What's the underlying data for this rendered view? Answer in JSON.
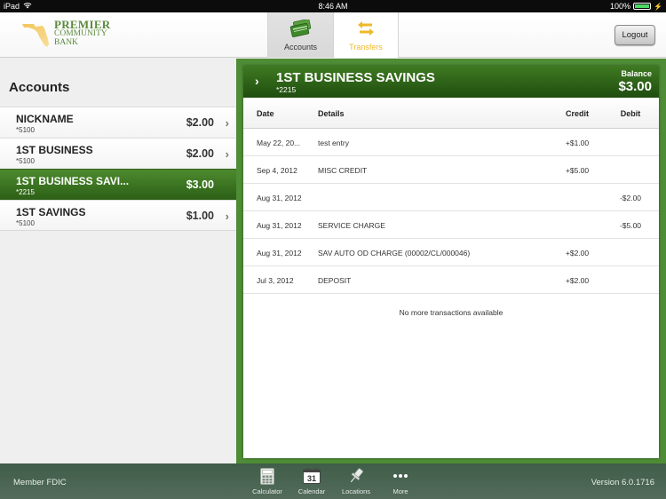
{
  "status_bar": {
    "device": "iPad",
    "time": "8:46 AM",
    "battery": "100%",
    "battery_level": 1.0
  },
  "header": {
    "logo": {
      "line1": "PREMIER",
      "line2": "COMMUNITY",
      "line3": "BANK",
      "icon": "florida-state-icon"
    },
    "tabs": [
      {
        "label": "Accounts",
        "icon": "credit-cards-icon",
        "active": true
      },
      {
        "label": "Transfers",
        "icon": "transfer-arrows-icon",
        "active": false
      }
    ],
    "logout_label": "Logout"
  },
  "colors": {
    "brand_green": "#3f7a22",
    "frame_green": "#4f8c36",
    "transfers_yellow": "#f0b92a",
    "footer_bg": "#4a6552"
  },
  "accounts_panel": {
    "title": "Accounts",
    "accounts": [
      {
        "name": "NICKNAME",
        "number": "*5100",
        "balance": "$2.00",
        "selected": false
      },
      {
        "name": "1ST BUSINESS",
        "number": "*5100",
        "balance": "$2.00",
        "selected": false
      },
      {
        "name": "1ST BUSINESS SAVI...",
        "number": "*2215",
        "balance": "$3.00",
        "selected": true
      },
      {
        "name": "1ST SAVINGS",
        "number": "*5100",
        "balance": "$1.00",
        "selected": false
      }
    ]
  },
  "account_detail": {
    "name": "1ST BUSINESS SAVINGS",
    "number": "*2215",
    "balance_label": "Balance",
    "balance": "$3.00",
    "columns": {
      "date": "Date",
      "details": "Details",
      "credit": "Credit",
      "debit": "Debit"
    },
    "transactions": [
      {
        "date": "May 22, 20...",
        "details": "test entry",
        "credit": "+$1.00",
        "debit": ""
      },
      {
        "date": "Sep 4, 2012",
        "details": "MISC CREDIT",
        "credit": "+$5.00",
        "debit": ""
      },
      {
        "date": "Aug 31, 2012",
        "details": "",
        "credit": "",
        "debit": "-$2.00"
      },
      {
        "date": "Aug 31, 2012",
        "details": "SERVICE CHARGE",
        "credit": "",
        "debit": "-$5.00"
      },
      {
        "date": "Aug 31, 2012",
        "details": "SAV AUTO OD CHARGE (00002/CL/000046)",
        "credit": "+$2.00",
        "debit": ""
      },
      {
        "date": "Jul 3, 2012",
        "details": "DEPOSIT",
        "credit": "+$2.00",
        "debit": ""
      }
    ],
    "end_message": "No more transactions available"
  },
  "footer": {
    "left_text": "Member FDIC",
    "version": "Version 6.0.1716",
    "tabs": [
      {
        "label": "Calculator",
        "icon": "calculator-icon"
      },
      {
        "label": "Calendar",
        "icon": "calendar-icon",
        "icon_text": "31"
      },
      {
        "label": "Locations",
        "icon": "pushpin-icon"
      },
      {
        "label": "More",
        "icon": "more-dots-icon"
      }
    ]
  }
}
